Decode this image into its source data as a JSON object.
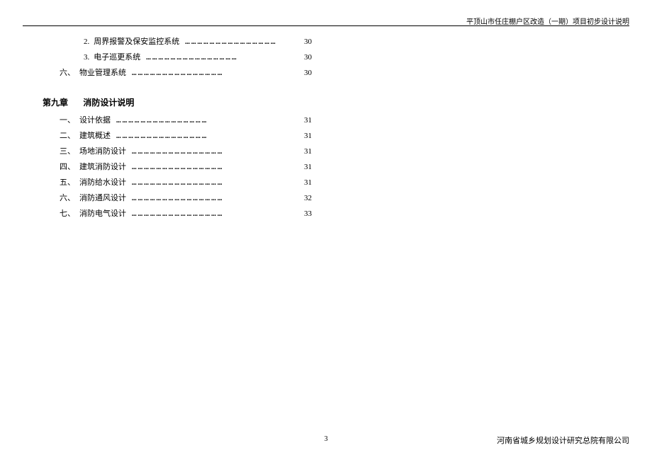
{
  "header": {
    "project_title": "平顶山市任庄棚户区改造（一期）项目初步设计说明"
  },
  "toc_upper": [
    {
      "indent": "indent-2",
      "num": "2.",
      "title": "周界报警及保安监控系统",
      "page": "30"
    },
    {
      "indent": "indent-2",
      "num": "3.",
      "title": "电子巡更系统",
      "page": "30"
    },
    {
      "indent": "indent-0",
      "num": "六、",
      "title": "物业管理系统",
      "page": "30"
    }
  ],
  "chapter": {
    "label": "第九章",
    "title": "消防设计说明"
  },
  "toc_lower": [
    {
      "indent": "indent-0",
      "num": "一、",
      "title": "设计依据",
      "page": "31"
    },
    {
      "indent": "indent-0",
      "num": "二、",
      "title": "建筑概述",
      "page": "31"
    },
    {
      "indent": "indent-0",
      "num": "三、",
      "title": "场地消防设计",
      "page": "31"
    },
    {
      "indent": "indent-0",
      "num": "四、",
      "title": "建筑消防设计",
      "page": "31"
    },
    {
      "indent": "indent-0",
      "num": "五、",
      "title": "消防给水设计",
      "page": "31"
    },
    {
      "indent": "indent-0",
      "num": "六、",
      "title": "消防通风设计",
      "page": "32"
    },
    {
      "indent": "indent-0",
      "num": "七、",
      "title": "消防电气设计",
      "page": "33"
    }
  ],
  "footer": {
    "page_number": "3",
    "organization": "河南省城乡规划设计研究总院有限公司"
  },
  "dotfill": "………………………………………"
}
